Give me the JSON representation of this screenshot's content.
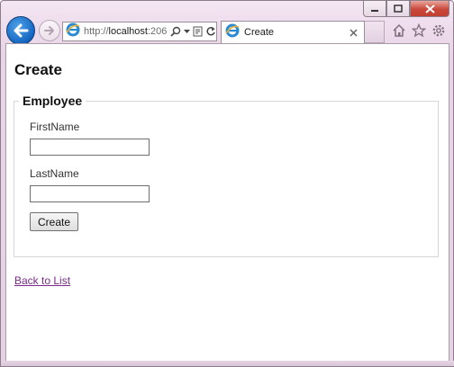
{
  "browser": {
    "address": {
      "scheme": "http://",
      "host": "localhost",
      "port_fragment": ":206"
    },
    "tab": {
      "label": "Create"
    },
    "icons": {
      "back": "back-arrow-icon",
      "forward": "forward-arrow-icon",
      "site": "ie-logo-icon",
      "search": "search-icon",
      "dropdown": "chevron-down-icon",
      "compat": "compatibility-view-icon",
      "refresh": "refresh-icon",
      "tab_close": "close-icon",
      "home": "home-icon",
      "favorites": "star-icon",
      "tools": "gear-icon"
    },
    "colors": {
      "accent": "#1565c0",
      "chrome": "#ecd9ea",
      "close_button": "#c9483a",
      "visited_link": "#7a2a8a"
    }
  },
  "page": {
    "title": "Create",
    "form": {
      "legend": "Employee",
      "fields": [
        {
          "label": "FirstName",
          "value": ""
        },
        {
          "label": "LastName",
          "value": ""
        }
      ],
      "submit_label": "Create"
    },
    "back_link": "Back to List"
  }
}
